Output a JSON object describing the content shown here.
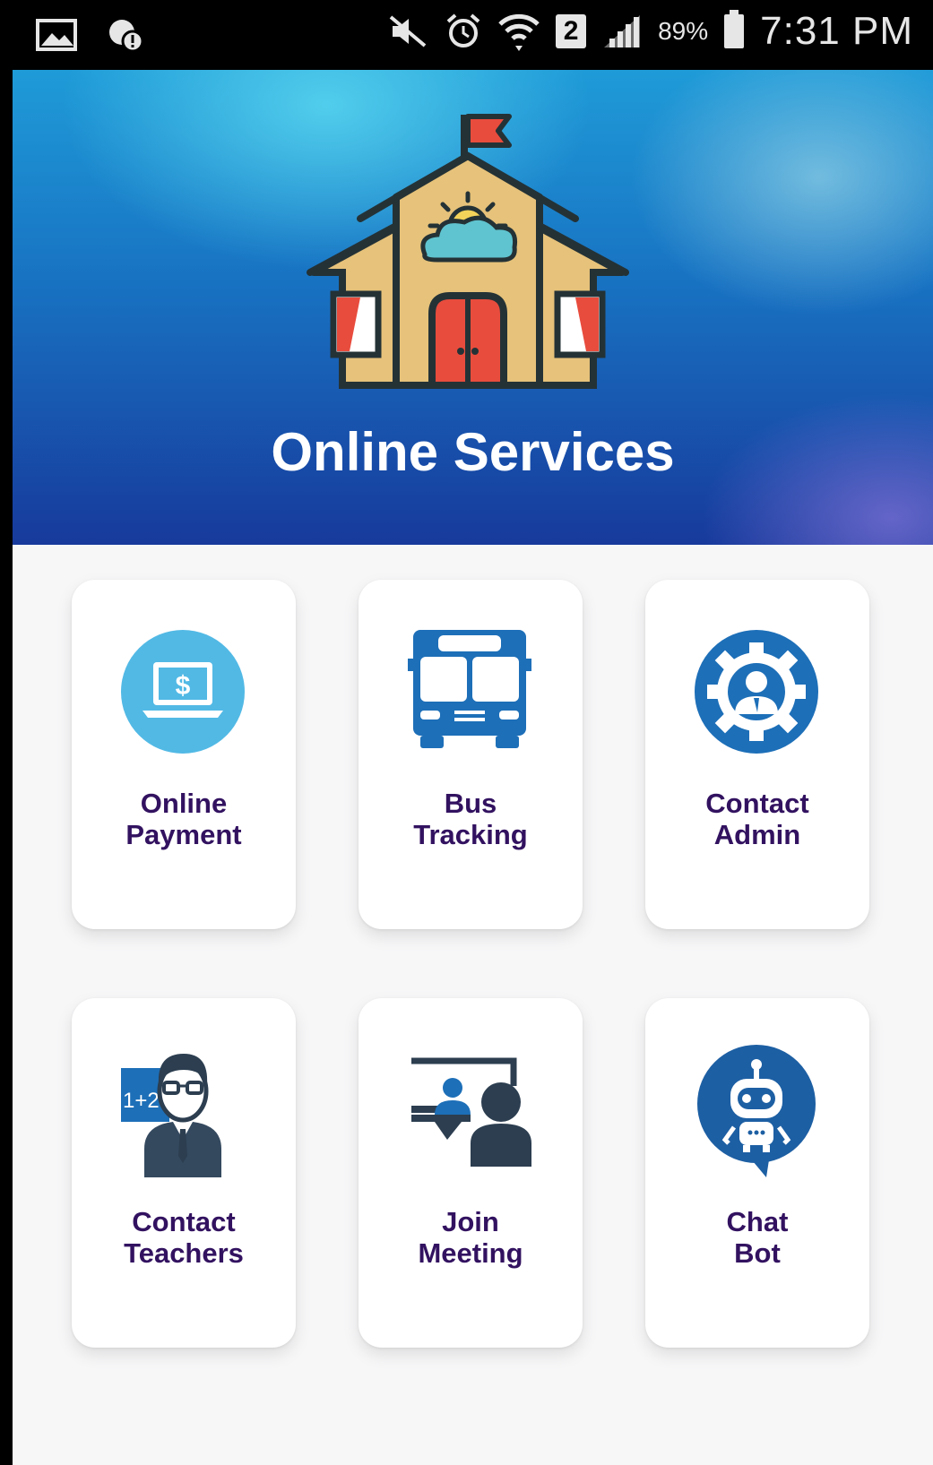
{
  "status_bar": {
    "battery_percent": "89%",
    "time": "7:31 PM",
    "sim_badge": "2"
  },
  "header": {
    "title": "Online Services"
  },
  "services": [
    {
      "line1": "Online",
      "line2": "Payment",
      "icon": "payment-icon"
    },
    {
      "line1": "Bus",
      "line2": "Tracking",
      "icon": "bus-icon"
    },
    {
      "line1": "Contact",
      "line2": "Admin",
      "icon": "admin-icon"
    },
    {
      "line1": "Contact",
      "line2": "Teachers",
      "icon": "teacher-icon"
    },
    {
      "line1": "Join",
      "line2": "Meeting",
      "icon": "meeting-icon"
    },
    {
      "line1": "Chat",
      "line2": "Bot",
      "icon": "chatbot-icon"
    }
  ],
  "icon_text": {
    "dollar": "$",
    "math": "1+2"
  },
  "colors": {
    "label": "#321260",
    "icon_blue": "#1d6fb8",
    "icon_light_blue": "#4cb8e6",
    "icon_dark": "#2c3e50"
  }
}
